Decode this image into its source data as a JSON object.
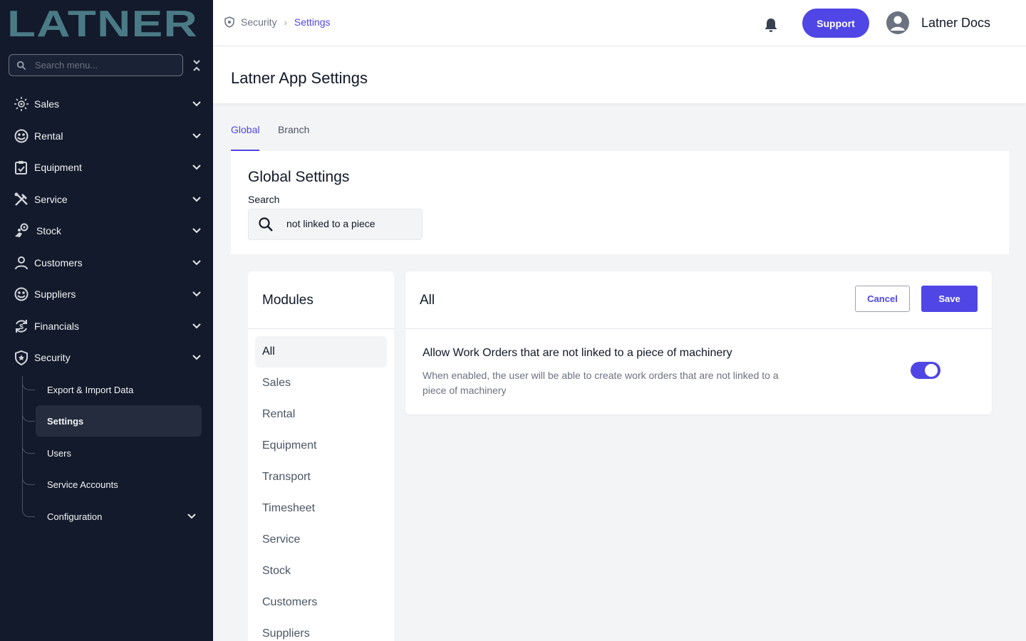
{
  "sidebar": {
    "logo_text": "LATNER",
    "search_placeholder": "Search menu...",
    "items": [
      {
        "label": "Sales",
        "icon": "sales-icon"
      },
      {
        "label": "Rental",
        "icon": "rental-icon"
      },
      {
        "label": "Equipment",
        "icon": "equipment-icon"
      },
      {
        "label": "Service",
        "icon": "service-tools-icon"
      },
      {
        "label": "Stock",
        "icon": "stock-icon"
      },
      {
        "label": "Customers",
        "icon": "customers-icon"
      },
      {
        "label": "Suppliers",
        "icon": "suppliers-icon"
      },
      {
        "label": "Financials",
        "icon": "financials-icon"
      },
      {
        "label": "Security",
        "icon": "shield-icon"
      }
    ],
    "security_sub": [
      {
        "label": "Export & Import Data"
      },
      {
        "label": "Settings"
      },
      {
        "label": "Users"
      },
      {
        "label": "Service Accounts"
      },
      {
        "label": "Configuration"
      }
    ]
  },
  "topbar": {
    "breadcrumb": {
      "section": "Security",
      "current": "Settings"
    },
    "support_label": "Support",
    "user_name": "Latner Docs"
  },
  "page": {
    "title": "Latner App Settings",
    "tabs": [
      {
        "label": "Global"
      },
      {
        "label": "Branch"
      }
    ],
    "global_settings": {
      "title": "Global Settings",
      "search_label": "Search",
      "search_value": "not linked to a piece"
    },
    "modules": {
      "title": "Modules",
      "items": [
        "All",
        "Sales",
        "Rental",
        "Equipment",
        "Transport",
        "Timesheet",
        "Service",
        "Stock",
        "Customers",
        "Suppliers"
      ]
    },
    "panel": {
      "title": "All",
      "cancel_label": "Cancel",
      "save_label": "Save",
      "setting": {
        "title": "Allow Work Orders that are not linked to a piece of machinery",
        "description": "When enabled, the user will be able to create work orders that are not linked to a piece of machinery",
        "enabled": true
      }
    }
  },
  "colors": {
    "sidebar_bg": "#131a2b",
    "accent": "#4f46e5",
    "logo": "#4a7a85"
  }
}
